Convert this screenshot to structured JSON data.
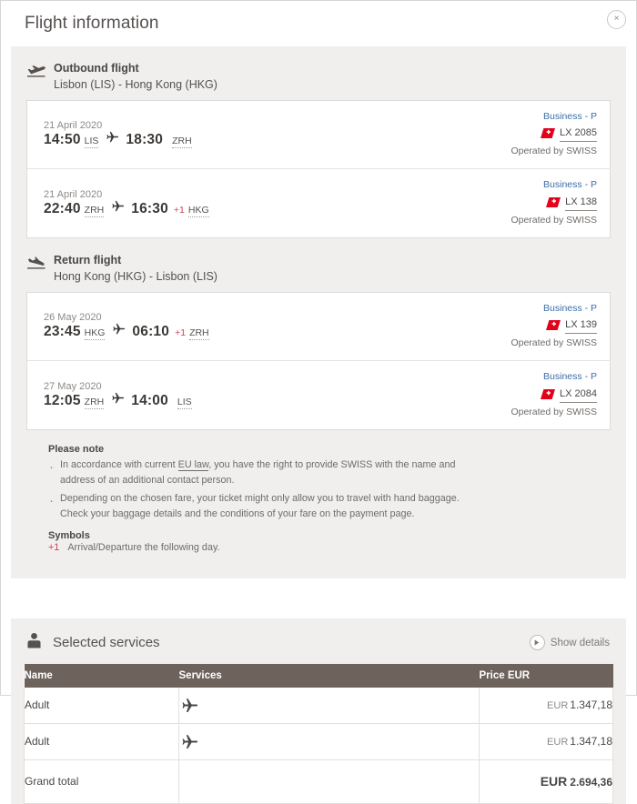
{
  "modal": {
    "title": "Flight information",
    "close_label": "×"
  },
  "outbound": {
    "icon": "plane-takeoff-icon",
    "title": "Outbound flight",
    "route": "Lisbon (LIS) - Hong Kong (HKG)",
    "segments": [
      {
        "date": "21 April 2020",
        "dep_time": "14:50",
        "dep_airport": "LIS",
        "arr_time": "18:30",
        "arr_airport": "ZRH",
        "next_day": "",
        "cabin": "Business - P",
        "flight_no": "LX 2085",
        "operated_by": "Operated by SWISS"
      },
      {
        "date": "21 April 2020",
        "dep_time": "22:40",
        "dep_airport": "ZRH",
        "arr_time": "16:30",
        "arr_airport": "HKG",
        "next_day": "+1",
        "cabin": "Business - P",
        "flight_no": "LX 138",
        "operated_by": "Operated by SWISS"
      }
    ]
  },
  "return_flight": {
    "icon": "plane-landing-icon",
    "title": "Return flight",
    "route": "Hong Kong (HKG) - Lisbon (LIS)",
    "segments": [
      {
        "date": "26 May 2020",
        "dep_time": "23:45",
        "dep_airport": "HKG",
        "arr_time": "06:10",
        "arr_airport": "ZRH",
        "next_day": "+1",
        "cabin": "Business - P",
        "flight_no": "LX 139",
        "operated_by": "Operated by SWISS"
      },
      {
        "date": "27 May 2020",
        "dep_time": "12:05",
        "dep_airport": "ZRH",
        "arr_time": "14:00",
        "arr_airport": "LIS",
        "next_day": "",
        "cabin": "Business - P",
        "flight_no": "LX 2084",
        "operated_by": "Operated by SWISS"
      }
    ]
  },
  "notes": {
    "title": "Please note",
    "item1_pre": "In accordance with current ",
    "item1_link": "EU law",
    "item1_post": ", you have the right to provide SWISS with the name and address of an additional contact person.",
    "item2": "Depending on the chosen fare, your ticket might only allow you to travel with hand baggage. Check your baggage details and the conditions of your fare on the payment page.",
    "symbols_title": "Symbols",
    "symbol_key": "+1",
    "symbol_text": "Arrival/Departure the following day."
  },
  "services": {
    "title": "Selected services",
    "show_details": "Show details",
    "columns": {
      "name": "Name",
      "services": "Services",
      "price": "Price EUR"
    },
    "rows": [
      {
        "name": "Adult",
        "service_icon": "plane-icon",
        "currency": "EUR",
        "price": "1.347,18"
      },
      {
        "name": "Adult",
        "service_icon": "plane-icon",
        "currency": "EUR",
        "price": "1.347,18"
      }
    ],
    "grand_total_label": "Grand total",
    "grand_total_currency": "EUR",
    "grand_total_value": "2.694,36"
  },
  "colors": {
    "panel_bg": "#f0efee",
    "table_header_bg": "#6d635c",
    "accent_red": "#cf4055",
    "cabin_blue": "#3a6ea8",
    "swiss_red": "#e2001a"
  }
}
